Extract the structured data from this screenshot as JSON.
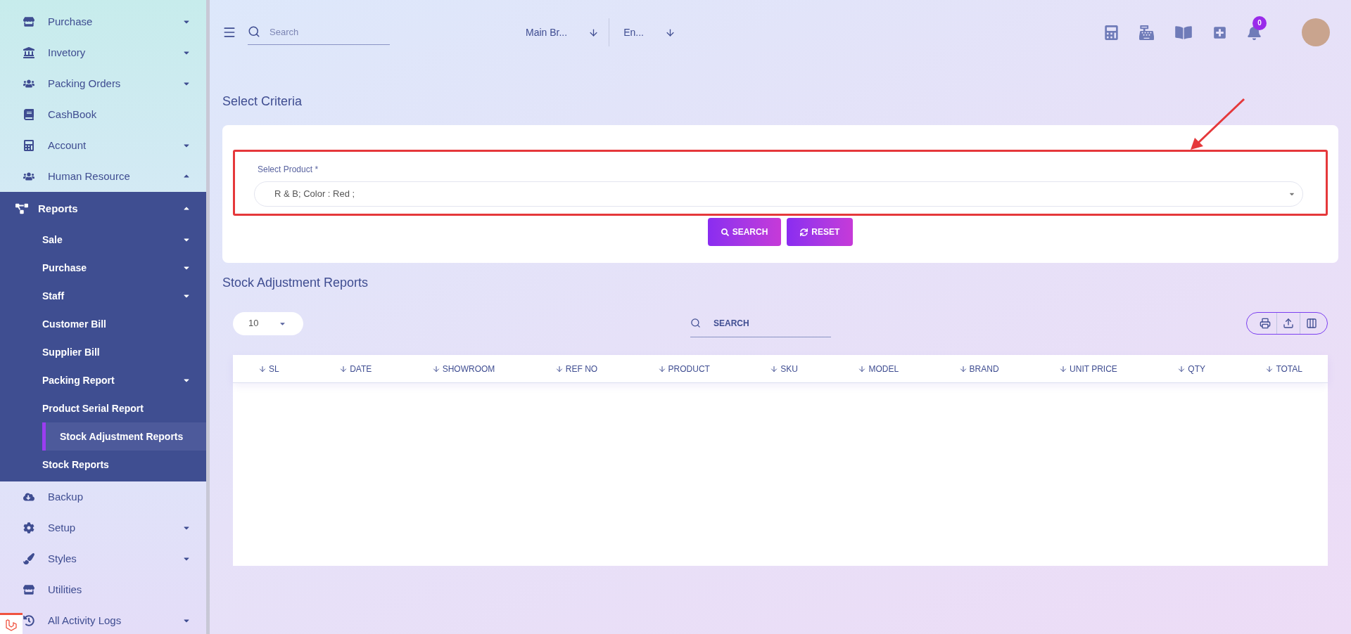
{
  "sidebar": {
    "items": [
      {
        "label": "Purchase",
        "kind": "group",
        "expanded": false
      },
      {
        "label": "Invetory",
        "kind": "group",
        "expanded": false
      },
      {
        "label": "Packing Orders",
        "kind": "group",
        "expanded": false
      },
      {
        "label": "CashBook",
        "kind": "link"
      },
      {
        "label": "Account",
        "kind": "group",
        "expanded": false
      },
      {
        "label": "Human Resource",
        "kind": "group",
        "expanded": true
      },
      {
        "label": "Reports",
        "kind": "group",
        "expanded": true,
        "children": [
          {
            "label": "Sale",
            "kind": "group",
            "expanded": false,
            "selected": false
          },
          {
            "label": "Purchase",
            "kind": "group",
            "expanded": false,
            "selected": false
          },
          {
            "label": "Staff",
            "kind": "group",
            "expanded": false,
            "selected": false
          },
          {
            "label": "Customer Bill",
            "kind": "link",
            "selected": false
          },
          {
            "label": "Supplier Bill",
            "kind": "link",
            "selected": false
          },
          {
            "label": "Packing Report",
            "kind": "group",
            "expanded": false,
            "selected": false
          },
          {
            "label": "Product Serial Report",
            "kind": "link",
            "selected": false
          },
          {
            "label": "Stock Adjustment Reports",
            "kind": "link",
            "selected": true
          },
          {
            "label": "Stock Reports",
            "kind": "link",
            "selected": false
          }
        ]
      },
      {
        "label": "Backup",
        "kind": "link"
      },
      {
        "label": "Setup",
        "kind": "group",
        "expanded": false
      },
      {
        "label": "Styles",
        "kind": "group",
        "expanded": false
      },
      {
        "label": "Utilities",
        "kind": "link"
      },
      {
        "label": "All Activity Logs",
        "kind": "group",
        "expanded": false
      }
    ]
  },
  "topbar": {
    "search": {
      "placeholder": "Search"
    },
    "branch": "Main Br...",
    "language": "En...",
    "notifications": "0"
  },
  "criteria": {
    "title": "Select Criteria",
    "field": {
      "label": "Select Product *",
      "value": "R & B; Color : Red ;",
      "highlighted": true
    },
    "buttons": [
      {
        "label": "SEARCH",
        "kind": "search"
      },
      {
        "label": "RESET",
        "kind": "reset"
      }
    ]
  },
  "report": {
    "title": "Stock Adjustment Reports",
    "page_size": "10",
    "search": {
      "placeholder": "SEARCH"
    },
    "table": {
      "columns": [
        "SL",
        "DATE",
        "SHOWROOM",
        "REF NO",
        "PRODUCT",
        "SKU",
        "MODEL",
        "BRAND",
        "UNIT PRICE",
        "QTY",
        "TOTAL"
      ]
    }
  }
}
